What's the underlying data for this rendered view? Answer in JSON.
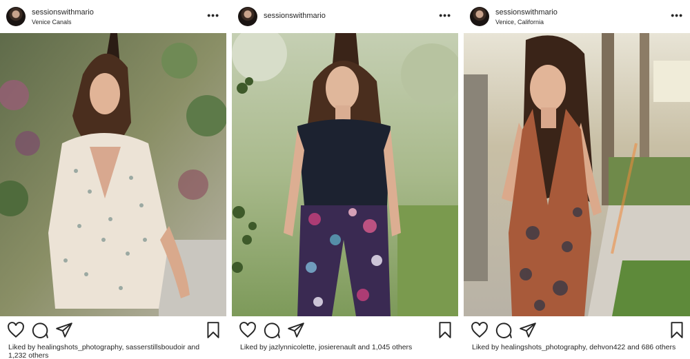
{
  "posts": [
    {
      "username": "sessionswithmario",
      "location": "Venice Canals",
      "more_label": "•••",
      "liked_prefix": "Liked by",
      "liker1": "healingshots_photography",
      "sep": ",",
      "liker2": "sasserstillsboudoir",
      "and_text": "and",
      "others": "1,232 others"
    },
    {
      "username": "sessionswithmario",
      "location": "",
      "more_label": "•••",
      "liked_prefix": "Liked by",
      "liker1": "jazlynnicolette",
      "sep": ",",
      "liker2": "josierenault",
      "and_text": "and",
      "others": "1,045 others"
    },
    {
      "username": "sessionswithmario",
      "location": "Venice, California",
      "more_label": "•••",
      "liked_prefix": "Liked by",
      "liker1": "healingshots_photography",
      "sep": ",",
      "liker2": "dehvon422",
      "and_text": "and",
      "others": "686 others"
    }
  ],
  "icons": [
    "heart-icon",
    "comment-icon",
    "share-icon",
    "bookmark-icon"
  ]
}
